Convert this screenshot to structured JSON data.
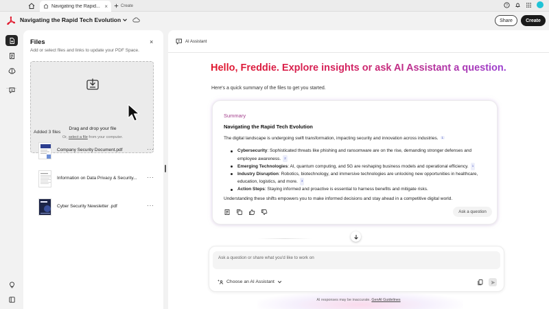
{
  "browser": {
    "tab_title": "Navigating the Rapid...",
    "tab_close": "×",
    "new_tab_label": "Create"
  },
  "header": {
    "doc_title": "Navigating the Rapid Tech Evolution",
    "share_label": "Share",
    "create_label": "Create"
  },
  "files_panel": {
    "title": "Files",
    "close": "×",
    "subtitle": "Add or select files and links to update your PDF Space.",
    "dropzone_title": "Drag and drop your file",
    "dropzone_or": "Or,",
    "dropzone_link": "select a file",
    "dropzone_tail": "from your computer.",
    "added_label": "Added 3 files",
    "more": "···",
    "files": [
      {
        "name": "Company Security Document.pdf"
      },
      {
        "name": "Information on Data Privacy & Security..."
      },
      {
        "name": "Cyber Security Newsletter .pdf"
      }
    ]
  },
  "assistant": {
    "tab_label": "AI Assistant",
    "greeting": "Hello, Freddie. Explore insights or ask AI Assistant a question.",
    "intro": "Here's a quick summary of the files to get you started.",
    "summary": {
      "label": "Summary",
      "title": "Navigating the Rapid Tech Evolution",
      "lead": "The digital landscape is undergoing swift transformation, impacting security and innovation across industries.",
      "lead_cite": "1",
      "bullets": [
        {
          "term": "Cybersecurity",
          "text": ": Sophisticated threats like phishing and ransomware are on the rise, demanding stronger defenses and employee awareness.",
          "cite": "2"
        },
        {
          "term": "Emerging Technologies",
          "text": ": AI, quantum computing, and 5G are reshaping business models and operational efficiency.",
          "cite": "1"
        },
        {
          "term": "Industry Disruption",
          "text": ": Robotics, biotechnology, and immersive technologies are unlocking new opportunities in healthcare, education, logistics, and more.",
          "cite": "3"
        },
        {
          "term": "Action Steps",
          "text": ": Staying informed and proactive is essential to harness benefits and mitigate risks.",
          "cite": ""
        }
      ],
      "closing": "Understanding these shifts empowers you to make informed decisions and stay ahead in a competitive digital world.",
      "ask_label": "Ask a question"
    },
    "input_placeholder": "Ask a question or share what you'd like to work on",
    "choose_label": "Choose an AI Assistant",
    "disclaimer_text": "AI responses may be inaccurate.",
    "disclaimer_link": "GenAI Guidelines"
  },
  "colors": {
    "brand_red": "#e0182d",
    "gradient_end": "#9b3fd1",
    "summary_label": "#a23d8b"
  }
}
